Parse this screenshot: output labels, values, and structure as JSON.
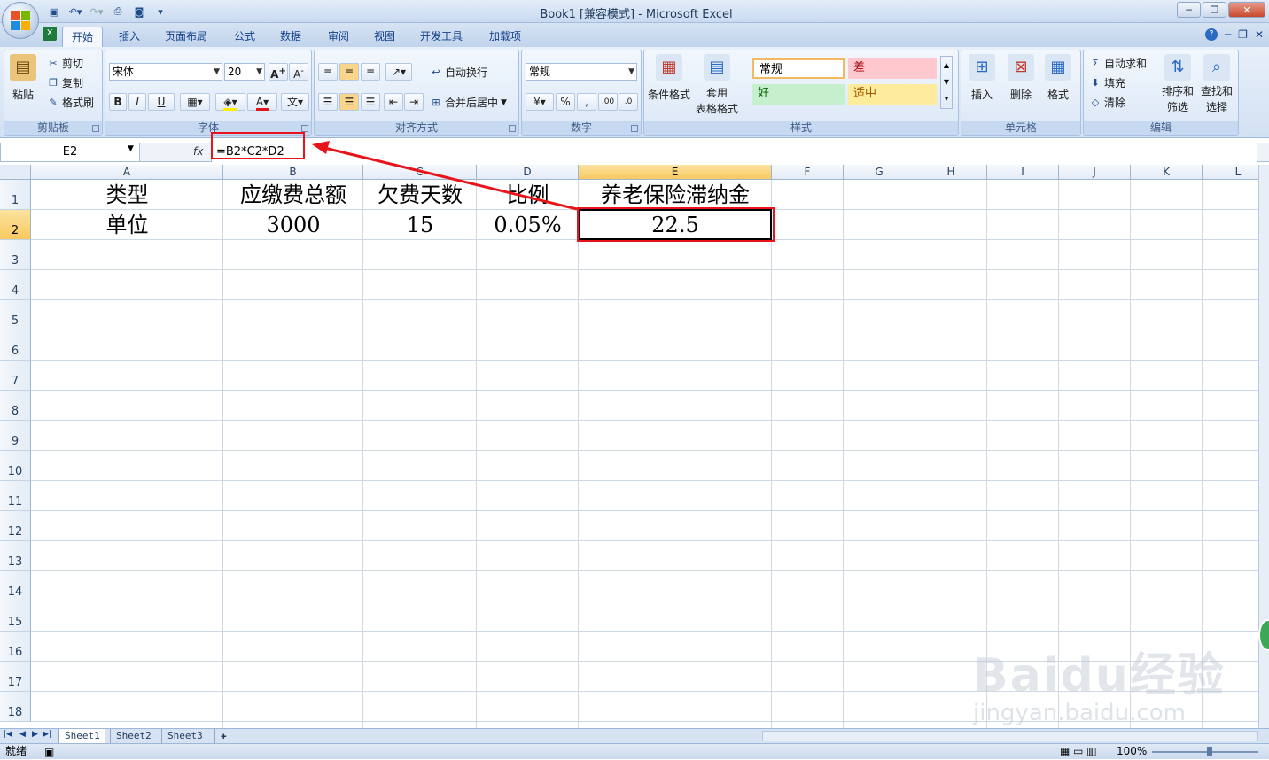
{
  "window": {
    "title": "Book1",
    "mode": "[兼容模式]",
    "app": "- Microsoft Excel"
  },
  "tabs": [
    "开始",
    "插入",
    "页面布局",
    "公式",
    "数据",
    "审阅",
    "视图",
    "开发工具",
    "加载项"
  ],
  "ribbon": {
    "clipboard": {
      "paste": "粘贴",
      "cut": "剪切",
      "copy": "复制",
      "format_painter": "格式刷",
      "label": "剪贴板"
    },
    "font": {
      "name": "宋体",
      "size": "20",
      "bold": "B",
      "italic": "I",
      "underline": "U",
      "label": "字体"
    },
    "alignment": {
      "wrap": "自动换行",
      "merge": "合并后居中",
      "label": "对齐方式"
    },
    "number": {
      "format": "常规",
      "percent": "%",
      "comma": ",",
      "label": "数字"
    },
    "styles": {
      "cond_format": "条件格式",
      "table_format_1": "套用",
      "table_format_2": "表格格式",
      "normal": "常规",
      "bad": "差",
      "good": "好",
      "neutral": "适中",
      "label": "样式"
    },
    "cells": {
      "insert": "插入",
      "delete": "删除",
      "format": "格式",
      "label": "单元格"
    },
    "editing": {
      "autosum": "自动求和",
      "fill": "填充",
      "clear": "清除",
      "sort_1": "排序和",
      "sort_2": "筛选",
      "find_1": "查找和",
      "find_2": "选择",
      "label": "编辑"
    }
  },
  "formula_bar": {
    "name_box": "E2",
    "fx": "fx",
    "formula": "=B2*C2*D2"
  },
  "columns": [
    "A",
    "B",
    "C",
    "D",
    "E",
    "F",
    "G",
    "H",
    "I",
    "J",
    "K",
    "L"
  ],
  "rows": [
    "1",
    "2",
    "3",
    "4",
    "5",
    "6",
    "7",
    "8",
    "9",
    "10",
    "11",
    "12",
    "13",
    "14",
    "15",
    "16",
    "17",
    "18"
  ],
  "cells": {
    "A1": "类型",
    "B1": "应缴费总额",
    "C1": "欠费天数",
    "D1": "比例",
    "E1": "养老保险滞纳金",
    "A2": "单位",
    "B2": "3000",
    "C2": "15",
    "D2": "0.05%",
    "E2": "22.5"
  },
  "sheets": [
    "Sheet1",
    "Sheet2",
    "Sheet3"
  ],
  "status": {
    "ready": "就绪",
    "zoom": "100%"
  },
  "watermark": {
    "main": "Baidu经验",
    "sub": "jingyan.baidu.com"
  },
  "colors": {
    "annotation": "#e8141a",
    "selected_header": "#f8c95f",
    "ribbon": "#d2e1f3"
  }
}
